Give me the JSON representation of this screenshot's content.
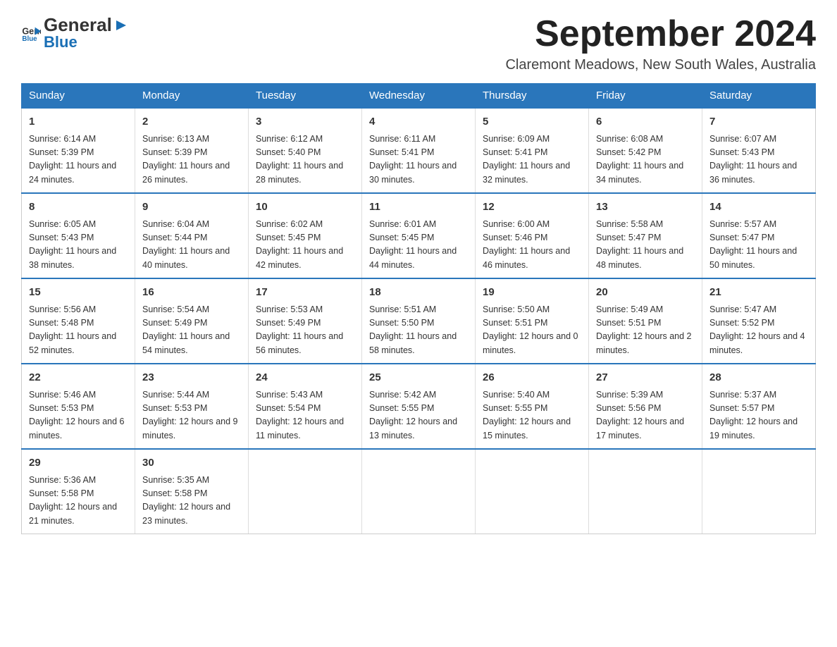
{
  "header": {
    "logo": {
      "text_general": "General",
      "text_blue": "Blue",
      "arrow_symbol": "▶"
    },
    "title": "September 2024",
    "subtitle": "Claremont Meadows, New South Wales, Australia"
  },
  "calendar": {
    "days_of_week": [
      "Sunday",
      "Monday",
      "Tuesday",
      "Wednesday",
      "Thursday",
      "Friday",
      "Saturday"
    ],
    "weeks": [
      [
        {
          "day": "1",
          "sunrise": "6:14 AM",
          "sunset": "5:39 PM",
          "daylight": "11 hours and 24 minutes."
        },
        {
          "day": "2",
          "sunrise": "6:13 AM",
          "sunset": "5:39 PM",
          "daylight": "11 hours and 26 minutes."
        },
        {
          "day": "3",
          "sunrise": "6:12 AM",
          "sunset": "5:40 PM",
          "daylight": "11 hours and 28 minutes."
        },
        {
          "day": "4",
          "sunrise": "6:11 AM",
          "sunset": "5:41 PM",
          "daylight": "11 hours and 30 minutes."
        },
        {
          "day": "5",
          "sunrise": "6:09 AM",
          "sunset": "5:41 PM",
          "daylight": "11 hours and 32 minutes."
        },
        {
          "day": "6",
          "sunrise": "6:08 AM",
          "sunset": "5:42 PM",
          "daylight": "11 hours and 34 minutes."
        },
        {
          "day": "7",
          "sunrise": "6:07 AM",
          "sunset": "5:43 PM",
          "daylight": "11 hours and 36 minutes."
        }
      ],
      [
        {
          "day": "8",
          "sunrise": "6:05 AM",
          "sunset": "5:43 PM",
          "daylight": "11 hours and 38 minutes."
        },
        {
          "day": "9",
          "sunrise": "6:04 AM",
          "sunset": "5:44 PM",
          "daylight": "11 hours and 40 minutes."
        },
        {
          "day": "10",
          "sunrise": "6:02 AM",
          "sunset": "5:45 PM",
          "daylight": "11 hours and 42 minutes."
        },
        {
          "day": "11",
          "sunrise": "6:01 AM",
          "sunset": "5:45 PM",
          "daylight": "11 hours and 44 minutes."
        },
        {
          "day": "12",
          "sunrise": "6:00 AM",
          "sunset": "5:46 PM",
          "daylight": "11 hours and 46 minutes."
        },
        {
          "day": "13",
          "sunrise": "5:58 AM",
          "sunset": "5:47 PM",
          "daylight": "11 hours and 48 minutes."
        },
        {
          "day": "14",
          "sunrise": "5:57 AM",
          "sunset": "5:47 PM",
          "daylight": "11 hours and 50 minutes."
        }
      ],
      [
        {
          "day": "15",
          "sunrise": "5:56 AM",
          "sunset": "5:48 PM",
          "daylight": "11 hours and 52 minutes."
        },
        {
          "day": "16",
          "sunrise": "5:54 AM",
          "sunset": "5:49 PM",
          "daylight": "11 hours and 54 minutes."
        },
        {
          "day": "17",
          "sunrise": "5:53 AM",
          "sunset": "5:49 PM",
          "daylight": "11 hours and 56 minutes."
        },
        {
          "day": "18",
          "sunrise": "5:51 AM",
          "sunset": "5:50 PM",
          "daylight": "11 hours and 58 minutes."
        },
        {
          "day": "19",
          "sunrise": "5:50 AM",
          "sunset": "5:51 PM",
          "daylight": "12 hours and 0 minutes."
        },
        {
          "day": "20",
          "sunrise": "5:49 AM",
          "sunset": "5:51 PM",
          "daylight": "12 hours and 2 minutes."
        },
        {
          "day": "21",
          "sunrise": "5:47 AM",
          "sunset": "5:52 PM",
          "daylight": "12 hours and 4 minutes."
        }
      ],
      [
        {
          "day": "22",
          "sunrise": "5:46 AM",
          "sunset": "5:53 PM",
          "daylight": "12 hours and 6 minutes."
        },
        {
          "day": "23",
          "sunrise": "5:44 AM",
          "sunset": "5:53 PM",
          "daylight": "12 hours and 9 minutes."
        },
        {
          "day": "24",
          "sunrise": "5:43 AM",
          "sunset": "5:54 PM",
          "daylight": "12 hours and 11 minutes."
        },
        {
          "day": "25",
          "sunrise": "5:42 AM",
          "sunset": "5:55 PM",
          "daylight": "12 hours and 13 minutes."
        },
        {
          "day": "26",
          "sunrise": "5:40 AM",
          "sunset": "5:55 PM",
          "daylight": "12 hours and 15 minutes."
        },
        {
          "day": "27",
          "sunrise": "5:39 AM",
          "sunset": "5:56 PM",
          "daylight": "12 hours and 17 minutes."
        },
        {
          "day": "28",
          "sunrise": "5:37 AM",
          "sunset": "5:57 PM",
          "daylight": "12 hours and 19 minutes."
        }
      ],
      [
        {
          "day": "29",
          "sunrise": "5:36 AM",
          "sunset": "5:58 PM",
          "daylight": "12 hours and 21 minutes."
        },
        {
          "day": "30",
          "sunrise": "5:35 AM",
          "sunset": "5:58 PM",
          "daylight": "12 hours and 23 minutes."
        },
        null,
        null,
        null,
        null,
        null
      ]
    ]
  }
}
